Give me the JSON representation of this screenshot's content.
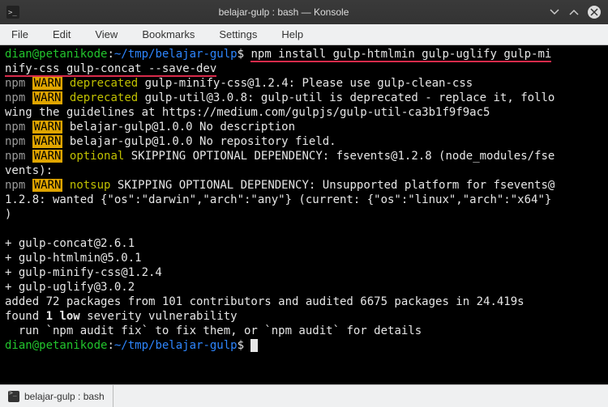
{
  "titlebar": {
    "title": "belajar-gulp : bash — Konsole"
  },
  "menubar": {
    "file": "File",
    "edit": "Edit",
    "view": "View",
    "bookmarks": "Bookmarks",
    "settings": "Settings",
    "help": "Help"
  },
  "term": {
    "prompt_user": "dian@petanikode",
    "prompt_colon": ":",
    "prompt_path": "~/tmp/belajar-gulp",
    "prompt_end": "$",
    "cmd_a": "npm install gulp-htmlmin gulp-uglify gulp-mi",
    "cmd_b": "nify-css gulp-concat --save-dev",
    "l1_npm": "npm",
    "l1_warn": "WARN",
    "l1_dep": "deprecated",
    "l1_rest": " gulp-minify-css@1.2.4: Please use gulp-clean-css",
    "l2_rest_a": " gulp-util@3.0.8: gulp-util is deprecated - replace it, follo",
    "l2_rest_b": "wing the guidelines at https://medium.com/gulpjs/gulp-util-ca3b1f9f9ac5",
    "l3_rest": " belajar-gulp@1.0.0 No description",
    "l4_rest": " belajar-gulp@1.0.0 No repository field.",
    "l5_opt": "optional",
    "l5_rest_a": " SKIPPING OPTIONAL DEPENDENCY: fsevents@1.2.8 (node_modules/fse",
    "l5_rest_b": "vents):",
    "l6_nsp": "notsup",
    "l6_rest_a": " SKIPPING OPTIONAL DEPENDENCY: Unsupported platform for fsevents@",
    "l6_rest_b": "1.2.8: wanted {\"os\":\"darwin\",\"arch\":\"any\"} (current: {\"os\":\"linux\",\"arch\":\"x64\"}",
    "l6_rest_c": ")",
    "pk1": "+ gulp-concat@2.6.1",
    "pk2": "+ gulp-htmlmin@5.0.1",
    "pk3": "+ gulp-minify-css@1.2.4",
    "pk4": "+ gulp-uglify@3.0.2",
    "added": "added 72 packages from 101 contributors and audited 6675 packages in 24.419s",
    "found_a": "found ",
    "found_b": "1",
    "found_c": " low",
    "found_d": " severity vulnerability",
    "audit": "  run `npm audit fix` to fix them, or `npm audit` for details"
  },
  "tab": {
    "label": "belajar-gulp : bash"
  }
}
